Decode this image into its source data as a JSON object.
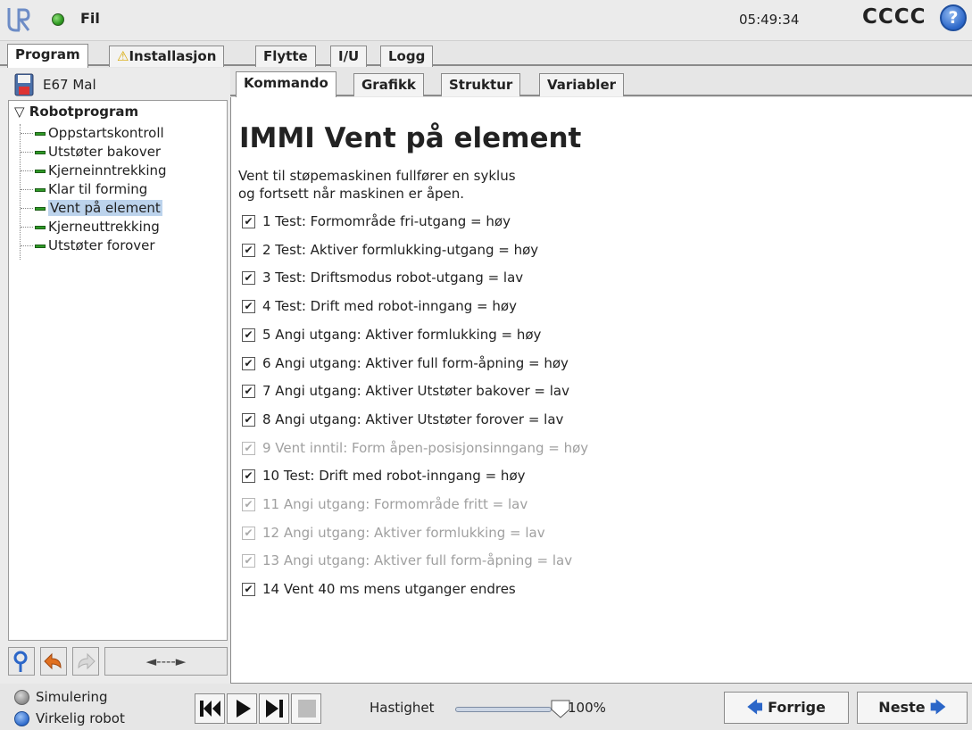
{
  "header": {
    "file_menu": "Fil",
    "clock": "05:49:34",
    "robot_name": "CCCC",
    "help_symbol": "?"
  },
  "main_tabs": [
    {
      "label": "Program",
      "active": true
    },
    {
      "label": "Installasjon",
      "active": false,
      "icon": "warning-icon"
    },
    {
      "label": "Flytte",
      "active": false
    },
    {
      "label": "I/U",
      "active": false
    },
    {
      "label": "Logg",
      "active": false
    }
  ],
  "program": {
    "name": "E67 Mal",
    "tree": {
      "root": "Robotprogram",
      "items": [
        {
          "label": "Oppstartskontroll"
        },
        {
          "label": "Utstøter bakover"
        },
        {
          "label": "Kjerneinntrekking"
        },
        {
          "label": "Klar til forming"
        },
        {
          "label": "Vent på element",
          "selected": true
        },
        {
          "label": "Kjerneuttrekking"
        },
        {
          "label": "Utstøter forover"
        }
      ]
    },
    "tools": {
      "arrows_label": "◄----►"
    }
  },
  "sub_tabs": [
    {
      "label": "Kommando",
      "active": true
    },
    {
      "label": "Grafikk",
      "active": false
    },
    {
      "label": "Struktur",
      "active": false
    },
    {
      "label": "Variabler",
      "active": false
    }
  ],
  "content": {
    "title": "IMMI Vent på element",
    "desc_line1": "Vent til støpemaskinen fullfører en syklus",
    "desc_line2": "og fortsett når maskinen er åpen.",
    "checks": [
      {
        "label": "1 Test: Formområde fri-utgang = høy",
        "checked": true,
        "enabled": true
      },
      {
        "label": "2 Test: Aktiver formlukking-utgang = høy",
        "checked": true,
        "enabled": true
      },
      {
        "label": "3 Test: Driftsmodus robot-utgang = lav",
        "checked": true,
        "enabled": true
      },
      {
        "label": "4 Test: Drift med robot-inngang = høy",
        "checked": true,
        "enabled": true
      },
      {
        "label": "5 Angi utgang: Aktiver formlukking = høy",
        "checked": true,
        "enabled": true
      },
      {
        "label": "6 Angi utgang: Aktiver full form-åpning = høy",
        "checked": true,
        "enabled": true
      },
      {
        "label": "7 Angi utgang: Aktiver Utstøter bakover = lav",
        "checked": true,
        "enabled": true
      },
      {
        "label": "8 Angi utgang: Aktiver Utstøter forover = lav",
        "checked": true,
        "enabled": true
      },
      {
        "label": "9 Vent inntil: Form åpen-posisjonsinngang = høy",
        "checked": true,
        "enabled": false
      },
      {
        "label": "10 Test: Drift med robot-inngang = høy",
        "checked": true,
        "enabled": true
      },
      {
        "label": "11 Angi utgang: Formområde fritt = lav",
        "checked": true,
        "enabled": false
      },
      {
        "label": "12 Angi utgang: Aktiver formlukking = lav",
        "checked": true,
        "enabled": false
      },
      {
        "label": "13 Angi utgang: Aktiver full form-åpning = lav",
        "checked": true,
        "enabled": false
      },
      {
        "label": "14 Vent 40 ms mens utganger endres",
        "checked": true,
        "enabled": true
      }
    ]
  },
  "footer": {
    "mode_simulation": "Simulering",
    "mode_real": "Virkelig robot",
    "speed_label": "Hastighet",
    "speed_value": "100%",
    "speed_fraction": 1.0,
    "prev_label": "Forrige",
    "next_label": "Neste"
  },
  "colors": {
    "accent_blue": "#2b66c8",
    "status_green": "#2f9a22",
    "warning_yellow": "#d8a800",
    "selection": "#bcd3ec"
  }
}
